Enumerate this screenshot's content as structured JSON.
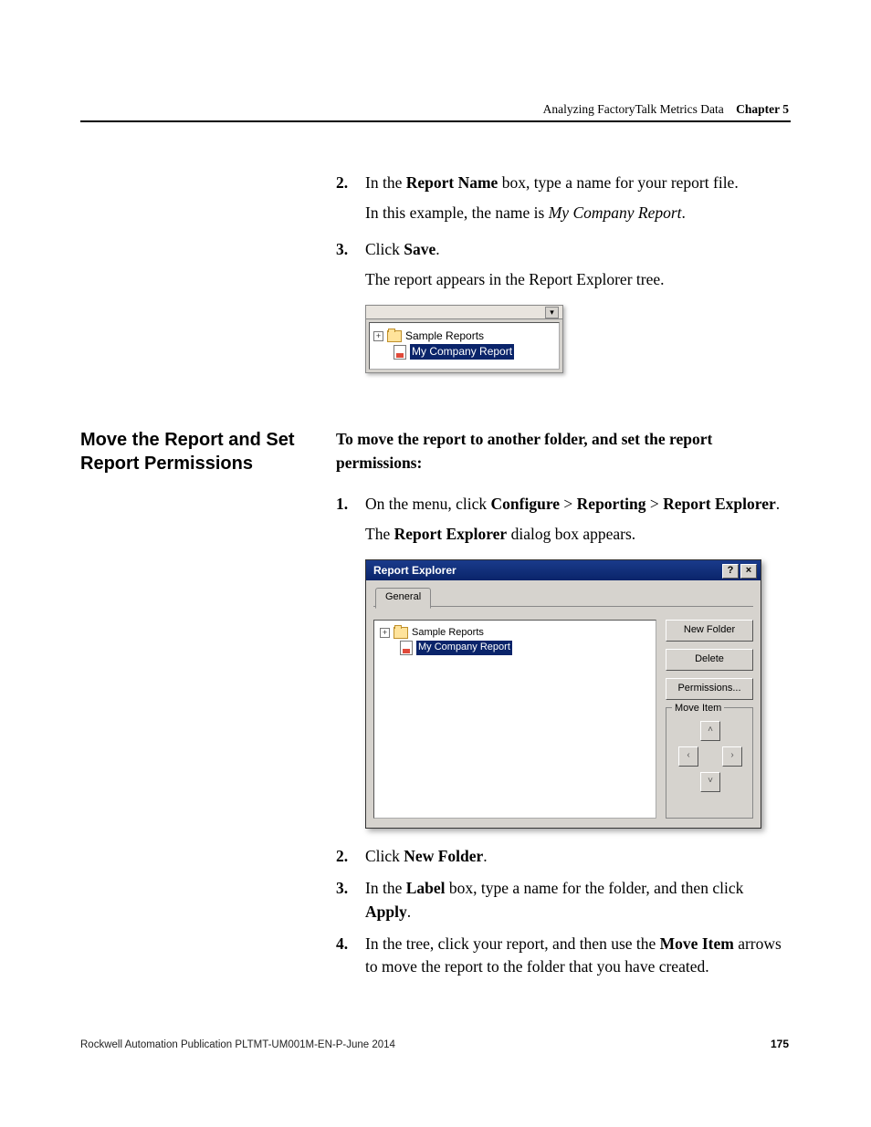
{
  "header": {
    "section": "Analyzing FactoryTalk Metrics Data",
    "chapter": "Chapter 5"
  },
  "intro_steps": {
    "s2_num": "2.",
    "s2_a": "In the ",
    "s2_b": "Report Name",
    "s2_c": " box, type a name for your report file.",
    "s2_sub": "In this example, the name is ",
    "s2_name": "My Company Report",
    "s2_dot": ".",
    "s3_num": "3.",
    "s3_a": "Click ",
    "s3_b": "Save",
    "s3_c": ".",
    "s3_sub": "The report appears in the Report Explorer tree."
  },
  "tree": {
    "sample": "Sample Reports",
    "my_report": "My Company Report"
  },
  "sidehead": "Move the Report and Set Report Permissions",
  "lead": "To move the report to another folder, and set the report permissions:",
  "move_steps": {
    "s1_num": "1.",
    "s1_a": "On the menu, click ",
    "s1_b": "Configure",
    "s1_gt1": " > ",
    "s1_c": "Reporting",
    "s1_gt2": " > ",
    "s1_d": "Report Explorer",
    "s1_e": ".",
    "s1_sub_a": "The ",
    "s1_sub_b": "Report Explorer",
    "s1_sub_c": " dialog box appears.",
    "s2_num": "2.",
    "s2_a": "Click ",
    "s2_b": "New Folder",
    "s2_c": ".",
    "s3_num": "3.",
    "s3_a": "In the ",
    "s3_b": "Label",
    "s3_c": " box, type a name for the folder, and then click ",
    "s3_d": "Apply",
    "s3_e": ".",
    "s4_num": "4.",
    "s4_a": "In the tree, click your report, and then use the ",
    "s4_b": "Move Item",
    "s4_c": " arrows to move the report to the folder that you have created."
  },
  "dialog": {
    "title": "Report Explorer",
    "tab": "General",
    "btn_new_folder": "New Folder",
    "btn_delete": "Delete",
    "btn_permissions": "Permissions...",
    "move_item": "Move Item",
    "help": "?",
    "close": "×",
    "up": "˄",
    "down": "˅",
    "left": "‹",
    "right": "›"
  },
  "footer": {
    "pub": "Rockwell Automation Publication PLTMT-UM001M-EN-P-June 2014",
    "page": "175"
  }
}
